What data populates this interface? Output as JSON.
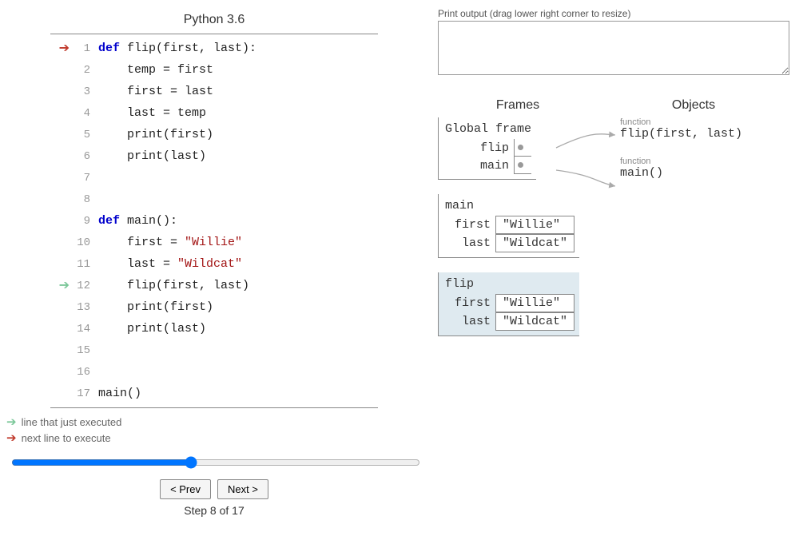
{
  "lang_header": "Python 3.6",
  "code_lines": [
    {
      "n": 1,
      "arrow": "red",
      "html": "<span class='kw'>def</span> flip(first, last):"
    },
    {
      "n": 2,
      "arrow": null,
      "html": "    temp = first"
    },
    {
      "n": 3,
      "arrow": null,
      "html": "    first = last"
    },
    {
      "n": 4,
      "arrow": null,
      "html": "    last = temp"
    },
    {
      "n": 5,
      "arrow": null,
      "html": "    print(first)"
    },
    {
      "n": 6,
      "arrow": null,
      "html": "    print(last)"
    },
    {
      "n": 7,
      "arrow": null,
      "html": ""
    },
    {
      "n": 8,
      "arrow": null,
      "html": ""
    },
    {
      "n": 9,
      "arrow": null,
      "html": "<span class='kw'>def</span> main():"
    },
    {
      "n": 10,
      "arrow": null,
      "html": "    first = <span class='str'>\"Willie\"</span>"
    },
    {
      "n": 11,
      "arrow": null,
      "html": "    last = <span class='str'>\"Wildcat\"</span>"
    },
    {
      "n": 12,
      "arrow": "green",
      "html": "    flip(first, last)"
    },
    {
      "n": 13,
      "arrow": null,
      "html": "    print(first)"
    },
    {
      "n": 14,
      "arrow": null,
      "html": "    print(last)"
    },
    {
      "n": 15,
      "arrow": null,
      "html": ""
    },
    {
      "n": 16,
      "arrow": null,
      "html": ""
    },
    {
      "n": 17,
      "arrow": null,
      "html": "main()"
    }
  ],
  "legend": {
    "green": "line that just executed",
    "red": "next line to execute"
  },
  "slider": {
    "min": 1,
    "max": 17,
    "value": 8
  },
  "buttons": {
    "prev": "< Prev",
    "next": "Next >"
  },
  "step_label": "Step 8 of 17",
  "print_label": "Print output (drag lower right corner to resize)",
  "print_output": "",
  "headers": {
    "frames": "Frames",
    "objects": "Objects"
  },
  "frames": {
    "global": {
      "title": "Global frame",
      "vars": [
        {
          "name": "flip",
          "pointer": true
        },
        {
          "name": "main",
          "pointer": true
        }
      ]
    },
    "main": {
      "title": "main",
      "vars": [
        {
          "name": "first",
          "value": "\"Willie\""
        },
        {
          "name": "last",
          "value": "\"Wildcat\""
        }
      ]
    },
    "flip": {
      "title": "flip",
      "vars": [
        {
          "name": "first",
          "value": "\"Willie\""
        },
        {
          "name": "last",
          "value": "\"Wildcat\""
        }
      ]
    }
  },
  "objects": [
    {
      "type": "function",
      "sig": "flip(first, last)"
    },
    {
      "type": "function",
      "sig": "main()"
    }
  ]
}
